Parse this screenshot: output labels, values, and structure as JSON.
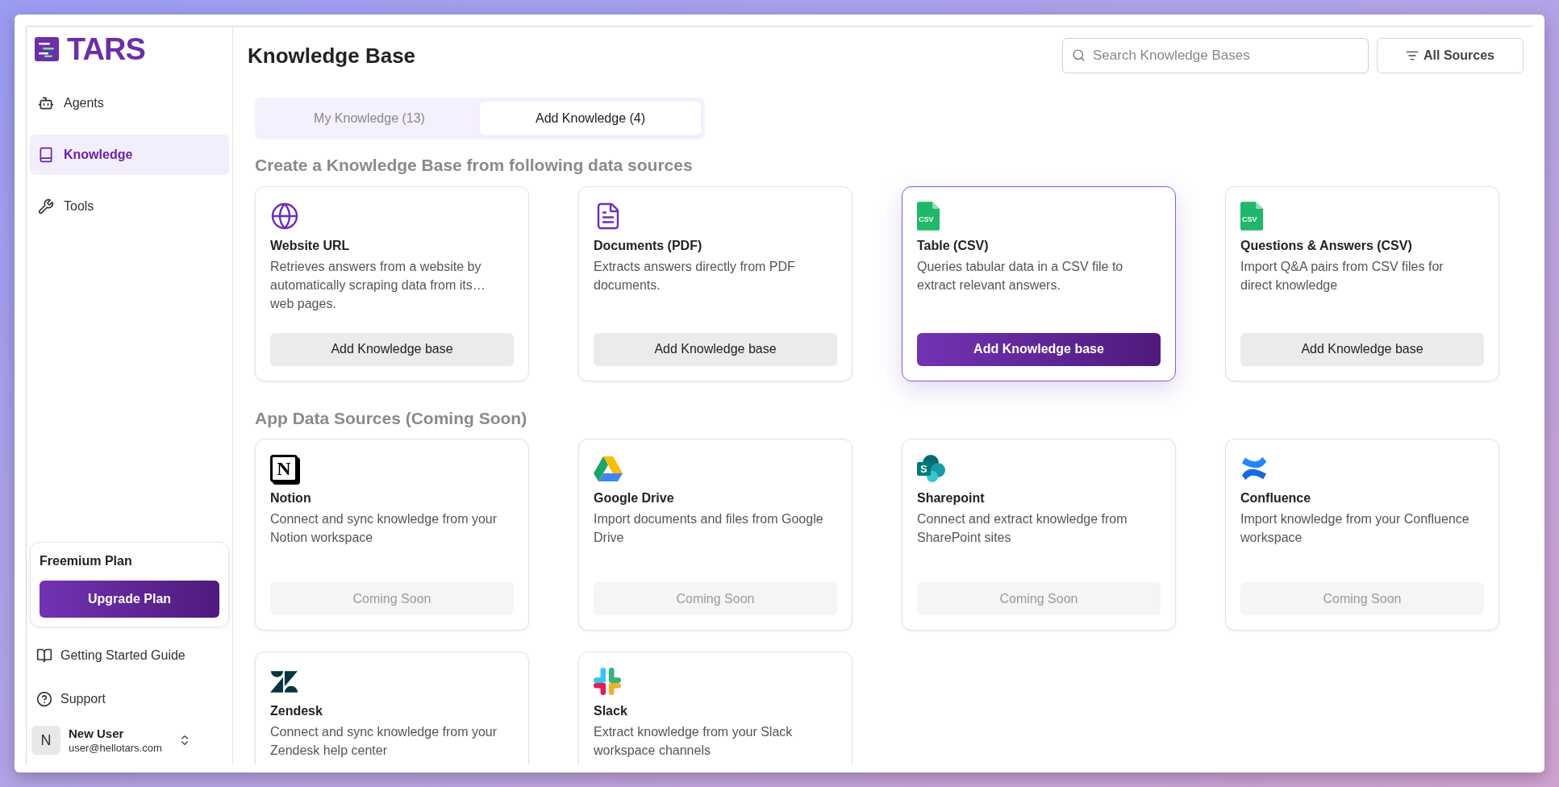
{
  "brand": {
    "name": "TARS"
  },
  "sidebar": {
    "items": [
      {
        "label": "Agents",
        "kind": "agents",
        "selected": false
      },
      {
        "label": "Knowledge",
        "kind": "knowledge",
        "selected": true
      },
      {
        "label": "Tools",
        "kind": "tools",
        "selected": false
      }
    ],
    "plan": {
      "title": "Freemium Plan",
      "button": "Upgrade Plan"
    },
    "links": [
      {
        "label": "Getting Started Guide",
        "kind": "guide"
      },
      {
        "label": "Support",
        "kind": "support"
      }
    ],
    "user": {
      "initial": "N",
      "name": "New User",
      "email": "user@hellotars.com"
    }
  },
  "header": {
    "title": "Knowledge Base",
    "search": {
      "placeholder": "Search Knowledge Bases"
    },
    "filter": "All Sources"
  },
  "tabs": [
    {
      "label": "My Knowledge (13)",
      "selected": false
    },
    {
      "label": "Add Knowledge (4)",
      "selected": true
    }
  ],
  "sections": [
    {
      "heading": "Create a Knowledge Base from following data sources",
      "cards": [
        {
          "kind": "website",
          "title": "Website URL",
          "description": "Retrieves answers from a website by automatically scraping data from its… web pages.",
          "button": "Add Knowledge base",
          "disabled": false,
          "selected": false
        },
        {
          "kind": "pdf",
          "title": "Documents (PDF)",
          "description": "Extracts answers directly from PDF documents.",
          "button": "Add Knowledge base",
          "disabled": false,
          "selected": false
        },
        {
          "kind": "csv",
          "icon_text": "CSV",
          "title": "Table (CSV)",
          "description": "Queries tabular data in a CSV file to extract relevant answers.",
          "button": "Add Knowledge base",
          "disabled": false,
          "selected": true
        },
        {
          "kind": "csv",
          "icon_text": "CSV",
          "title": "Questions & Answers (CSV)",
          "description": "Import Q&A pairs from CSV files for direct knowledge",
          "button": "Add Knowledge base",
          "disabled": false,
          "selected": false
        }
      ]
    },
    {
      "heading": "App Data Sources (Coming Soon)",
      "cards": [
        {
          "kind": "notion",
          "icon_text": "N",
          "title": "Notion",
          "description": "Connect and sync knowledge from your Notion workspace",
          "button": "Coming Soon",
          "disabled": true,
          "selected": false
        },
        {
          "kind": "drive",
          "title": "Google Drive",
          "description": "Import documents and files from Google Drive",
          "button": "Coming Soon",
          "disabled": true,
          "selected": false
        },
        {
          "kind": "sharepoint",
          "icon_text": "S",
          "title": "Sharepoint",
          "description": "Connect and extract knowledge from SharePoint sites",
          "button": "Coming Soon",
          "disabled": true,
          "selected": false
        },
        {
          "kind": "confluence",
          "title": "Confluence",
          "description": "Import knowledge from your Confluence workspace",
          "button": "Coming Soon",
          "disabled": true,
          "selected": false
        },
        {
          "kind": "zendesk",
          "title": "Zendesk",
          "description": "Connect and sync knowledge from your Zendesk help center",
          "selected": false
        },
        {
          "kind": "slack",
          "title": "Slack",
          "description": "Extract knowledge from your Slack workspace channels",
          "selected": false
        }
      ]
    }
  ]
}
